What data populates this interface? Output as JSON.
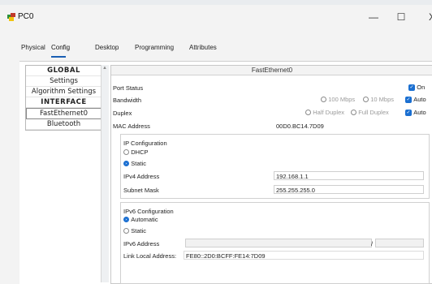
{
  "window": {
    "title": "PC0",
    "minimize": "—",
    "maximize": "☐",
    "close": "X"
  },
  "tabs": [
    "Physical",
    "Config",
    "Desktop",
    "Programming",
    "Attributes"
  ],
  "sidebar": {
    "items": [
      {
        "label": "GLOBAL",
        "kind": "header"
      },
      {
        "label": "Settings",
        "kind": "item"
      },
      {
        "label": "Algorithm Settings",
        "kind": "item"
      },
      {
        "label": "INTERFACE",
        "kind": "header"
      },
      {
        "label": "FastEthernet0",
        "kind": "selected"
      },
      {
        "label": "Bluetooth",
        "kind": "item"
      }
    ]
  },
  "panel": {
    "title": "FastEthernet0",
    "port_status": {
      "label": "Port Status",
      "checkbox": "On",
      "checked": true
    },
    "bandwidth": {
      "label": "Bandwidth",
      "opt1": "100 Mbps",
      "opt2": "10 Mbps",
      "auto": "Auto",
      "auto_checked": true
    },
    "duplex": {
      "label": "Duplex",
      "opt1": "Half Duplex",
      "opt2": "Full Duplex",
      "auto": "Auto",
      "auto_checked": true
    },
    "mac": {
      "label": "MAC Address",
      "value": "00D0.BC14.7D09"
    }
  },
  "ipv4": {
    "title": "IP Configuration",
    "dhcp": "DHCP",
    "static": "Static",
    "selected": "Static",
    "address_label": "IPv4 Address",
    "address": "192.168.1.1",
    "mask_label": "Subnet Mask",
    "mask": "255.255.255.0"
  },
  "ipv6": {
    "title": "IPv6 Configuration",
    "automatic": "Automatic",
    "static": "Static",
    "selected": "Automatic",
    "address_label": "IPv6 Address",
    "address": "",
    "prefix_sep": "/",
    "link_local_label": "Link Local Address:",
    "link_local": "FE80::2D0:BCFF:FE14:7D09"
  },
  "colors": {
    "accent": "#1a6fd1",
    "tab_underline": "#1a5fb4"
  }
}
